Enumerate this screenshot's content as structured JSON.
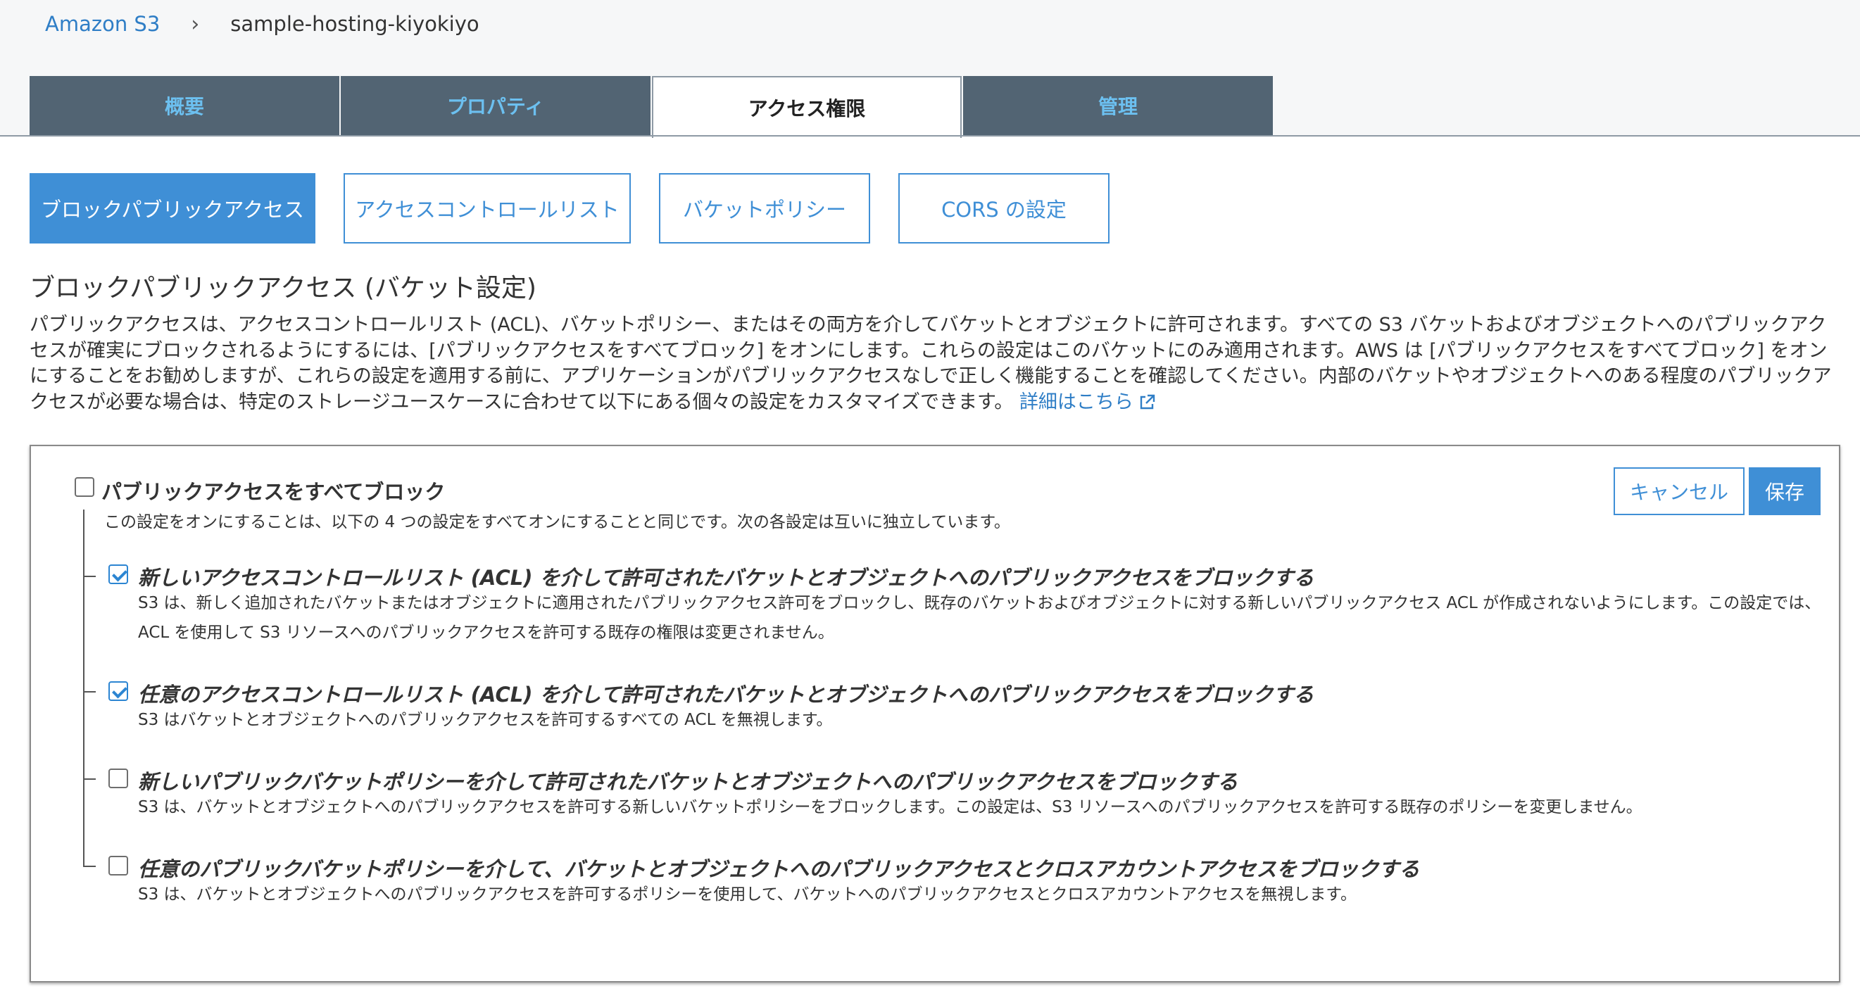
{
  "breadcrumb": {
    "root": "Amazon S3",
    "separator": "›",
    "current": "sample-hosting-kiyokiyo"
  },
  "tabs": [
    {
      "label": "概要",
      "active": false
    },
    {
      "label": "プロパティ",
      "active": false
    },
    {
      "label": "アクセス権限",
      "active": true
    },
    {
      "label": "管理",
      "active": false
    }
  ],
  "subtabs": [
    {
      "label": "ブロックパブリックアクセス",
      "active": true
    },
    {
      "label": "アクセスコントロールリスト",
      "active": false
    },
    {
      "label": "バケットポリシー",
      "active": false
    },
    {
      "label": "CORS の設定",
      "active": false
    }
  ],
  "section": {
    "title": "ブロックパブリックアクセス (バケット設定)",
    "description": "パブリックアクセスは、アクセスコントロールリスト (ACL)、バケットポリシー、またはその両方を介してバケットとオブジェクトに許可されます。すべての S3 バケットおよびオブジェクトへのパブリックアクセスが確実にブロックされるようにするには、[パブリックアクセスをすべてブロック] をオンにします。これらの設定はこのバケットにのみ適用されます。AWS は [パブリックアクセスをすべてブロック] をオンにすることをお勧めしますが、これらの設定を適用する前に、アプリケーションがパブリックアクセスなしで正しく機能することを確認してください。内部のバケットやオブジェクトへのある程度のパブリックアクセスが必要な場合は、特定のストレージユースケースに合わせて以下にある個々の設定をカスタマイズできます。",
    "learn_more": "詳細はこちら"
  },
  "panel": {
    "block_all": {
      "label": "パブリックアクセスをすべてブロック",
      "description": "この設定をオンにすることは、以下の 4 つの設定をすべてオンにすることと同じです。次の各設定は互いに独立しています。",
      "checked": false
    },
    "items": [
      {
        "label": "新しいアクセスコントロールリスト (ACL) を介して許可されたバケットとオブジェクトへのパブリックアクセスをブロックする",
        "description": "S3 は、新しく追加されたバケットまたはオブジェクトに適用されたパブリックアクセス許可をブロックし、既存のバケットおよびオブジェクトに対する新しいパブリックアクセス ACL が作成されないようにします。この設定では、ACL を使用して S3 リソースへのパブリックアクセスを許可する既存の権限は変更されません。",
        "checked": true
      },
      {
        "label": "任意のアクセスコントロールリスト (ACL) を介して許可されたバケットとオブジェクトへのパブリックアクセスをブロックする",
        "description": "S3 はバケットとオブジェクトへのパブリックアクセスを許可するすべての ACL を無視します。",
        "checked": true
      },
      {
        "label": "新しいパブリックバケットポリシーを介して許可されたバケットとオブジェクトへのパブリックアクセスをブロックする",
        "description": "S3 は、バケットとオブジェクトへのパブリックアクセスを許可する新しいバケットポリシーをブロックします。この設定は、S3 リソースへのパブリックアクセスを許可する既存のポリシーを変更しません。",
        "checked": false
      },
      {
        "label": "任意のパブリックバケットポリシーを介して、バケットとオブジェクトへのパブリックアクセスとクロスアカウントアクセスをブロックする",
        "description": "S3 は、バケットとオブジェクトへのパブリックアクセスを許可するポリシーを使用して、バケットへのパブリックアクセスとクロスアカウントアクセスを無視します。",
        "checked": false
      }
    ],
    "cancel_label": "キャンセル",
    "save_label": "保存"
  },
  "colors": {
    "accent": "#3f8fd6",
    "tab_bg": "#526473",
    "tab_text": "#6cc0f0",
    "link": "#2f7ec6"
  }
}
